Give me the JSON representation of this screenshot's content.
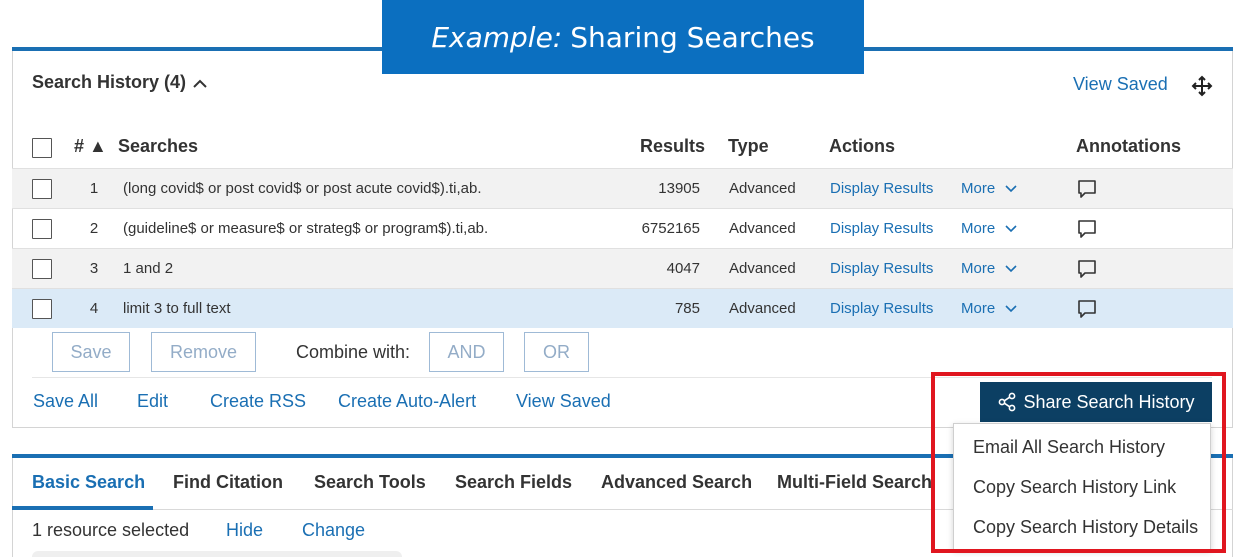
{
  "banner": {
    "prefix": "Example:",
    "title": "Sharing Searches"
  },
  "history": {
    "title": "Search History (4)",
    "view_saved": "View Saved",
    "columns": {
      "num": "#",
      "sort_indicator": "▲",
      "searches": "Searches",
      "results": "Results",
      "type": "Type",
      "actions": "Actions",
      "annotations": "Annotations"
    },
    "rows": [
      {
        "num": "1",
        "query": "(long covid$ or post covid$ or post acute covid$).ti,ab.",
        "results": "13905",
        "type": "Advanced",
        "display": "Display Results",
        "more": "More"
      },
      {
        "num": "2",
        "query": "(guideline$ or measure$ or strateg$ or program$).ti,ab.",
        "results": "6752165",
        "type": "Advanced",
        "display": "Display Results",
        "more": "More"
      },
      {
        "num": "3",
        "query": "1 and 2",
        "results": "4047",
        "type": "Advanced",
        "display": "Display Results",
        "more": "More"
      },
      {
        "num": "4",
        "query": "limit 3 to full text",
        "results": "785",
        "type": "Advanced",
        "display": "Display Results",
        "more": "More"
      }
    ],
    "buttons": {
      "save": "Save",
      "remove": "Remove",
      "combine_label": "Combine with:",
      "and": "AND",
      "or": "OR"
    },
    "links": {
      "save_all": "Save All",
      "edit": "Edit",
      "create_rss": "Create RSS",
      "create_auto_alert": "Create Auto-Alert",
      "view_saved": "View Saved"
    },
    "share": {
      "button": "Share Search History",
      "menu": [
        "Email All Search History",
        "Copy Search History Link",
        "Copy Search History Details"
      ]
    }
  },
  "search": {
    "tabs": [
      "Basic Search",
      "Find Citation",
      "Search Tools",
      "Search Fields",
      "Advanced Search",
      "Multi-Field Search"
    ],
    "active_tab": "Basic Search",
    "resources": {
      "selected": "1 resource selected",
      "hide": "Hide",
      "change": "Change"
    }
  },
  "colors": {
    "accent": "#1a6fb3",
    "banner": "#0b6fc0",
    "share_button": "#0c3f63",
    "highlight_box": "#e0161f",
    "selected_row": "#dbeaf7"
  }
}
